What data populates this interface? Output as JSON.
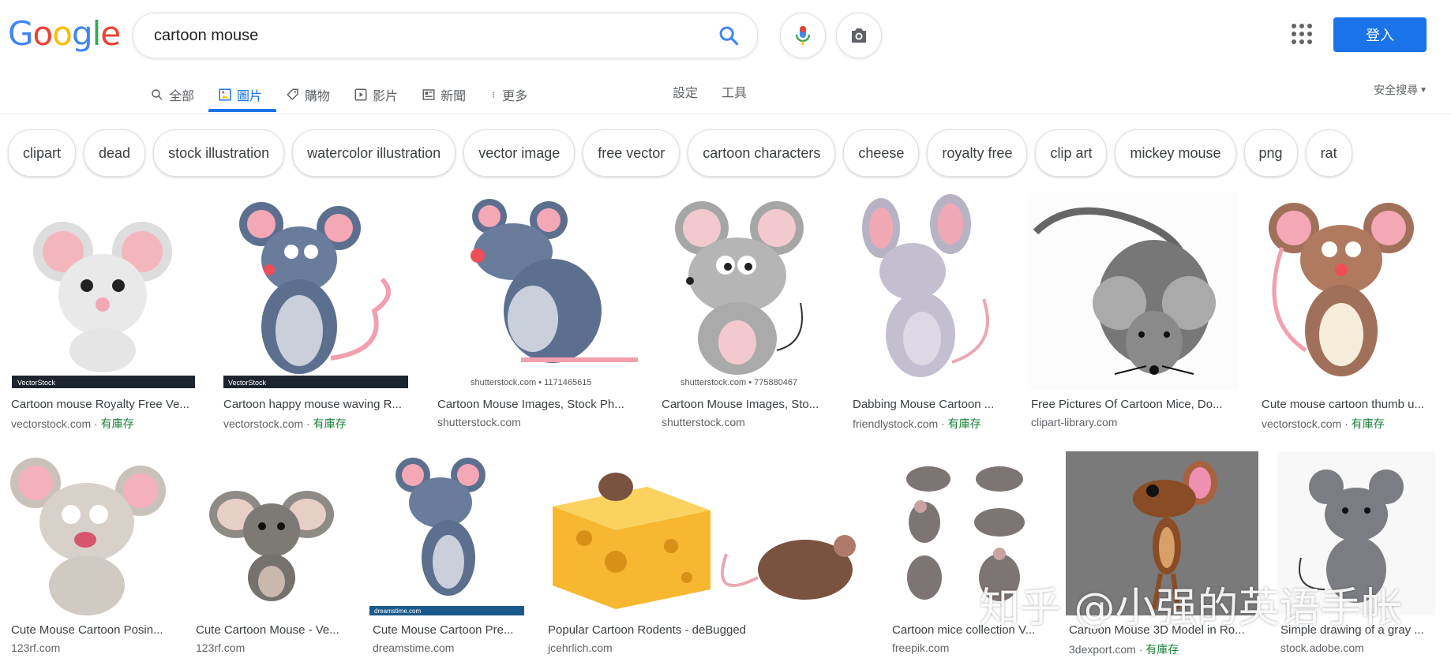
{
  "logo": {
    "letters": [
      "G",
      "o",
      "o",
      "g",
      "l",
      "e"
    ],
    "colors": [
      "#4285f4",
      "#ea4335",
      "#fbbc05",
      "#4285f4",
      "#34a853",
      "#ea4335"
    ]
  },
  "search": {
    "value": "cartoon mouse"
  },
  "header": {
    "signin_label": "登入"
  },
  "tabs": [
    {
      "label": "全部",
      "icon": "search-icon"
    },
    {
      "label": "圖片",
      "icon": "image-icon",
      "active": true
    },
    {
      "label": "購物",
      "icon": "tag-icon"
    },
    {
      "label": "影片",
      "icon": "play-icon"
    },
    {
      "label": "新聞",
      "icon": "news-icon"
    },
    {
      "label": "更多",
      "icon": "more-icon"
    }
  ],
  "tools": {
    "settings": "設定",
    "tools": "工具",
    "safe_search": "安全搜尋"
  },
  "chips": [
    "clipart",
    "dead",
    "stock illustration",
    "watercolor illustration",
    "vector image",
    "free vector",
    "cartoon characters",
    "cheese",
    "royalty free",
    "clip art",
    "mickey mouse",
    "png",
    "rat"
  ],
  "stock_label": "有庫存",
  "results_row1": [
    {
      "title": "Cartoon mouse Royalty Free Ve...",
      "source": "vectorstock.com",
      "stock": true,
      "watermark": "VectorStock"
    },
    {
      "title": "Cartoon happy mouse waving R...",
      "source": "vectorstock.com",
      "stock": true,
      "watermark": "VectorStock"
    },
    {
      "title": "Cartoon Mouse Images, Stock Ph...",
      "source": "shutterstock.com",
      "stock": false,
      "watermark": "shutterstock.com • 1171465615"
    },
    {
      "title": "Cartoon Mouse Images, Sto...",
      "source": "shutterstock.com",
      "stock": false,
      "watermark": "shutterstock.com • 775880467"
    },
    {
      "title": "Dabbing Mouse Cartoon ...",
      "source": "friendlystock.com",
      "stock": true,
      "watermark": ""
    },
    {
      "title": "Free Pictures Of Cartoon Mice, Do...",
      "source": "clipart-library.com",
      "stock": false,
      "watermark": ""
    },
    {
      "title": "Cute mouse cartoon thumb u...",
      "source": "vectorstock.com",
      "stock": true,
      "watermark": ""
    }
  ],
  "results_row2": [
    {
      "title": "Cute Mouse Cartoon Posin...",
      "source": "123rf.com",
      "stock": false
    },
    {
      "title": "Cute Cartoon Mouse - Ve...",
      "source": "123rf.com",
      "stock": false
    },
    {
      "title": "Cute Mouse Cartoon Pre...",
      "source": "dreamstime.com",
      "stock": false,
      "watermark": "dreamstime.com"
    },
    {
      "title": "Popular Cartoon Rodents - deBugged",
      "source": "jcehrlich.com",
      "stock": false
    },
    {
      "title": "Cartoon mice collection V...",
      "source": "freepik.com",
      "stock": false
    },
    {
      "title": "Cartoon Mouse 3D Model in Ro...",
      "source": "3dexport.com",
      "stock": true
    },
    {
      "title": "Simple drawing of a gray ...",
      "source": "stock.adobe.com",
      "stock": false
    }
  ],
  "overlay_watermark": "知乎 @小强的英语手帐"
}
